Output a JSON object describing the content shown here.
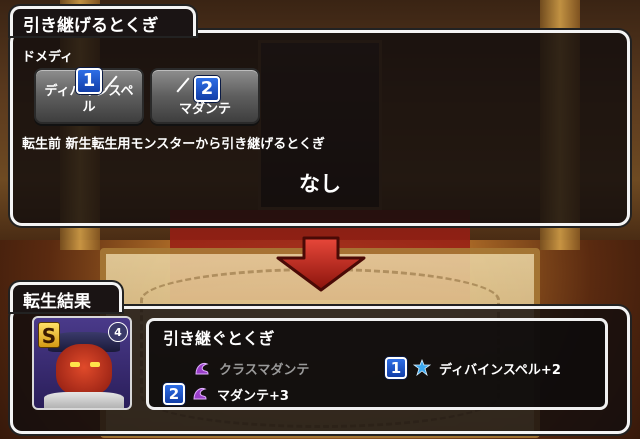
{
  "header": {
    "title": "引き継げるとくぎ"
  },
  "source": {
    "monster_name": "ドメディ",
    "skills": [
      {
        "number": "1",
        "label": "ディバインスペル"
      },
      {
        "number": "2",
        "label": "マダンテ"
      }
    ],
    "description": "転生前 新生転生用モンスターから引き継げるとくぎ",
    "none_text": "なし"
  },
  "result": {
    "title": "転生結果",
    "rank": "S",
    "plus_level": "4",
    "inherit_title": "引き継ぐとくぎ",
    "skills": [
      {
        "label": "クラスマダンテ",
        "icon": "purple-spell-icon",
        "active": false
      },
      {
        "number": "1",
        "label": "ディバインスペル+2",
        "icon": "blue-star-icon",
        "active": true
      },
      {
        "number": "2",
        "label": "マダンテ+3",
        "icon": "purple-spell-icon",
        "active": true
      }
    ]
  },
  "colors": {
    "badge_blue": "#1f56c8",
    "arrow_red": "#c8281c",
    "panel_bg": "#141010"
  }
}
